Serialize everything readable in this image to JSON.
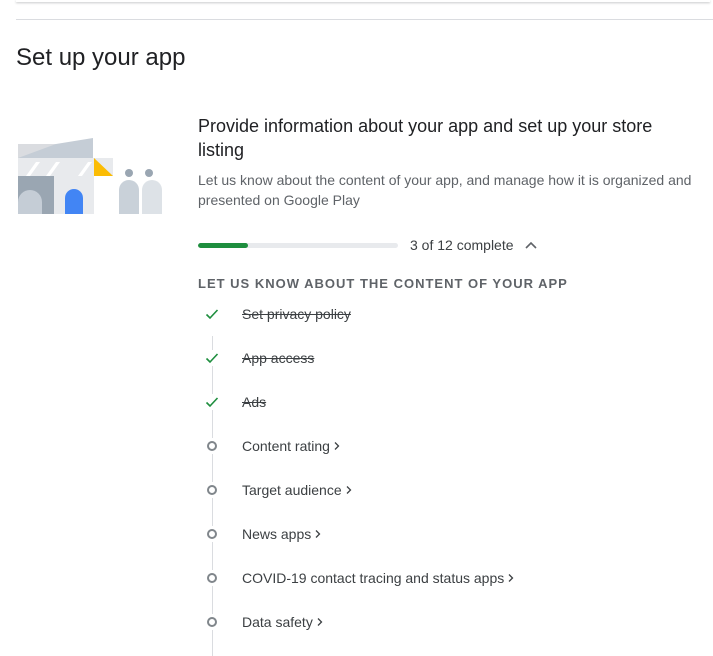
{
  "section": {
    "title": "Set up your app"
  },
  "card": {
    "heading": "Provide information about your app and set up your store listing",
    "description": "Let us know about the content of your app, and manage how it is organized and presented on Google Play",
    "progress": {
      "completed": 3,
      "total": 12,
      "fraction": 0.25,
      "label": "3 of 12 complete"
    },
    "group_title": "LET US KNOW ABOUT THE CONTENT OF YOUR APP",
    "tasks": [
      {
        "label": "Set privacy policy",
        "done": true
      },
      {
        "label": "App access",
        "done": true
      },
      {
        "label": "Ads",
        "done": true
      },
      {
        "label": "Content rating",
        "done": false
      },
      {
        "label": "Target audience",
        "done": false
      },
      {
        "label": "News apps",
        "done": false
      },
      {
        "label": "COVID-19 contact tracing and status apps",
        "done": false
      },
      {
        "label": "Data safety",
        "done": false
      }
    ]
  },
  "colors": {
    "progress_fill": "#1e8e3e",
    "check": "#1e8e3e",
    "illustration_blue": "#4285f4",
    "illustration_yellow": "#fbbc04",
    "illustration_gray": "#bdc1c6"
  },
  "icons": {
    "collapse": "chevron-up-icon",
    "done": "check-icon",
    "pending": "circle-icon",
    "open": "chevron-right-icon"
  }
}
